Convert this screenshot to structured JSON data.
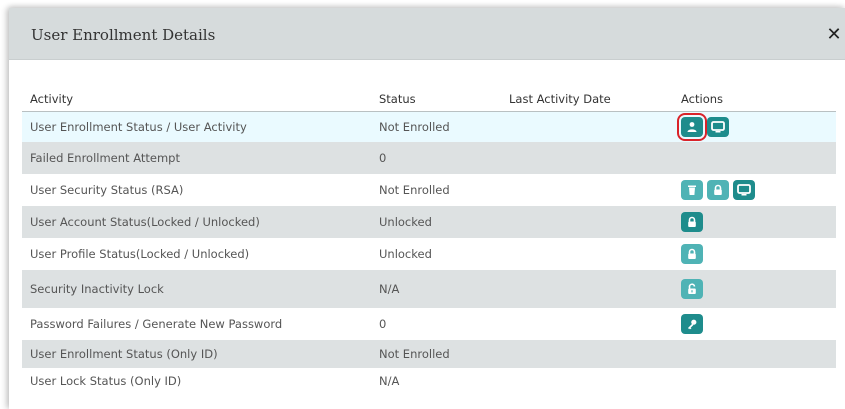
{
  "modal": {
    "title": "User Enrollment Details",
    "close_label": "✕"
  },
  "table": {
    "headers": {
      "activity": "Activity",
      "status": "Status",
      "last_activity_date": "Last Activity Date",
      "actions": "Actions"
    },
    "rows": [
      {
        "activity": "User Enrollment Status / User Activity",
        "status": "Not Enrolled",
        "date": "",
        "actions": [
          "user-icon",
          "monitor-icon"
        ]
      },
      {
        "activity": "Failed Enrollment Attempt",
        "status": "0",
        "date": "",
        "actions": []
      },
      {
        "activity": "User Security Status (RSA)",
        "status": "Not Enrolled",
        "date": "",
        "actions": [
          "trash-icon",
          "lock-icon",
          "monitor-icon"
        ]
      },
      {
        "activity": "User Account Status(Locked / Unlocked)",
        "status": "Unlocked",
        "date": "",
        "actions": [
          "lock-icon"
        ]
      },
      {
        "activity": "User Profile Status(Locked / Unlocked)",
        "status": "Unlocked",
        "date": "",
        "actions": [
          "lock-icon"
        ]
      },
      {
        "activity": "Security Inactivity Lock",
        "status": "N/A",
        "date": "",
        "actions": [
          "unlock-icon"
        ]
      },
      {
        "activity": "Password Failures / Generate New Password",
        "status": "0",
        "date": "",
        "actions": [
          "key-icon"
        ]
      },
      {
        "activity": "User Enrollment Status (Only ID)",
        "status": "Not Enrolled",
        "date": "",
        "actions": []
      },
      {
        "activity": "User Lock Status (Only ID)",
        "status": "N/A",
        "date": "",
        "actions": []
      }
    ]
  },
  "colors": {
    "accent": "#1e8c8c",
    "accent_light": "#4fb3b5",
    "highlight_row": "#eafaff",
    "alt_row": "#dde1e2",
    "header_bg": "#d6dbdc",
    "focus_outline": "#d9232a"
  }
}
